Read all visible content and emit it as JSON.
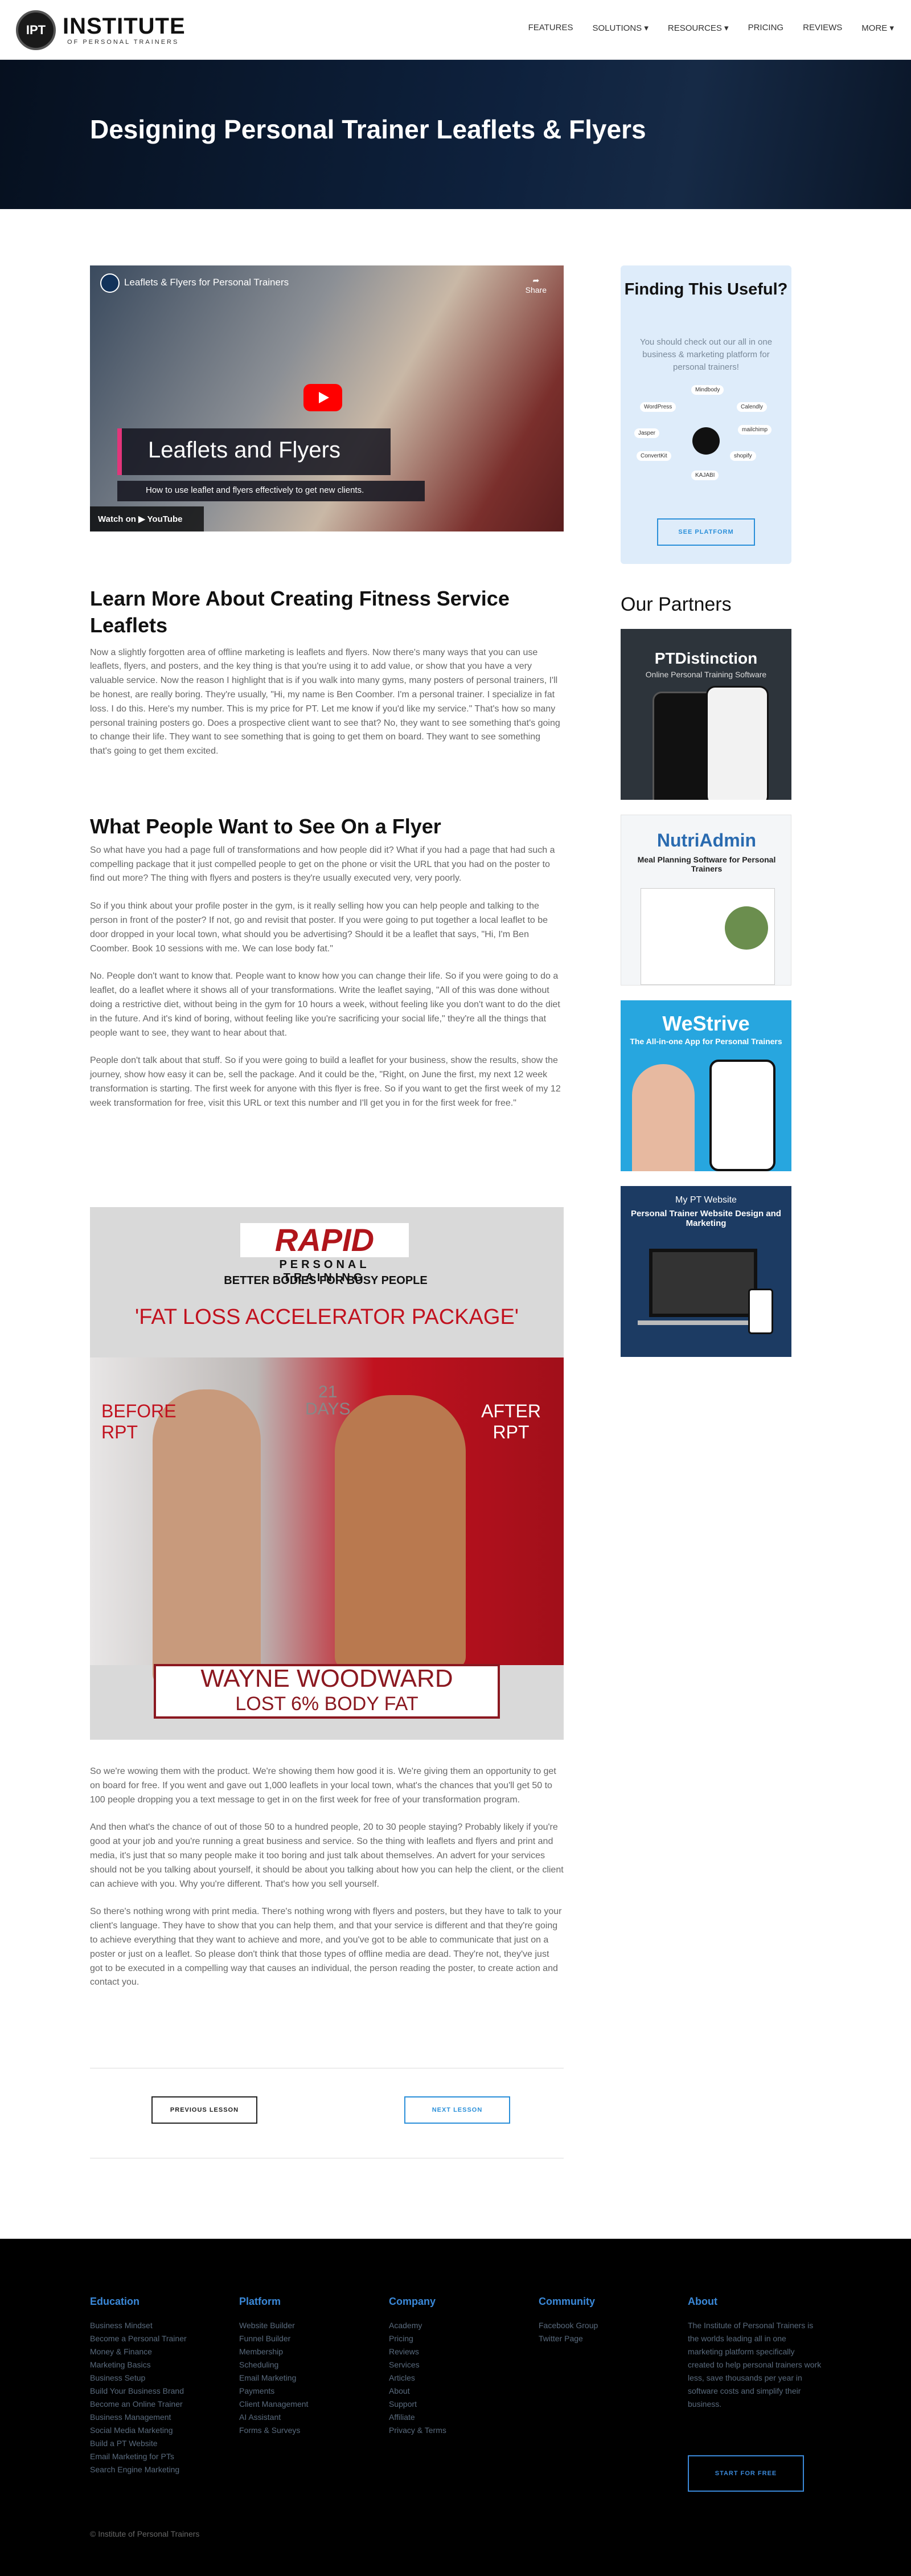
{
  "nav": {
    "logo_mark": "IPT",
    "logo_title": "INSTITUTE",
    "logo_sub": "OF PERSONAL TRAINERS",
    "items": [
      "FEATURES",
      "SOLUTIONS ▾",
      "RESOURCES ▾",
      "PRICING",
      "REVIEWS",
      "MORE ▾"
    ]
  },
  "hero": {
    "title": "Designing Personal Trainer Leaflets & Flyers"
  },
  "video": {
    "title": "Leaflets & Flyers for Personal Trainers",
    "share": "Share",
    "band": "Leaflets and Flyers",
    "subtitle": "How to use leaflet and flyers effectively to get new clients.",
    "watch": "Watch on ▶ YouTube"
  },
  "article": {
    "h1": "Learn More About Creating Fitness Service Leaflets",
    "p1": "Now a slightly forgotten area of offline marketing is leaflets and flyers. Now there's many ways that you can use leaflets, flyers, and posters, and the key thing is that you're using it to add value, or show that you have a very valuable service. Now the reason I highlight that is if you walk into many gyms, many posters of personal trainers, I'll be honest, are really boring. They're usually, \"Hi, my name is Ben Coomber. I'm a personal trainer. I specialize in fat loss. I do this. Here's my number. This is my price for PT. Let me know if you'd like my service.\" That's how so many personal training posters go. Does a prospective client want to see that? No, they want to see something that's going to change their life. They want to see something that is going to get them on board. They want to see something that's going to get them excited.",
    "h2": "What People Want to See On a Flyer",
    "p2": "So what have you had a page full of transformations and how people did it? What if you had a page that had such a compelling package that it just compelled people to get on the phone or visit the URL that you had on the poster to find out more? The thing with flyers and posters is they're usually executed very, very poorly.",
    "p3": "So if you think about your profile poster in the gym, is it really selling how you can help people and talking to the person in front of the poster? If not, go and revisit that poster. If you were going to put together a local leaflet to be door dropped in your local town, what should you be advertising? Should it be a leaflet that says, \"Hi, I'm Ben Coomber. Book 10 sessions with me. We can lose body fat.\"",
    "p4": "No. People don't want to know that. People want to know how you can change their life. So if you were going to do a leaflet, do a leaflet where it shows all of your transformations. Write the leaflet saying, \"All of this was done without doing a restrictive diet, without being in the gym for 10 hours a week, without feeling like you don't want to do the diet in the future. And it's kind of boring, without feeling like you're sacrificing your social life,\" they're all the things that people want to see, they want to hear about that.",
    "p5": "People don't talk about that stuff. So if you were going to build a leaflet for your business, show the results, show the journey, show how easy it can be, sell the package. And it could be the, \"Right, on June the first, my next 12 week transformation is starting. The first week for anyone with this flyer is free. So if you want to get the first week of my 12 week transformation for free, visit this URL or text this number and I'll get you in for the first week for free.\"",
    "p6": "So we're wowing them with the product. We're showing them how good it is. We're giving them an opportunity to get on board for free. If you went and gave out 1,000 leaflets in your local town, what's the chances that you'll get 50 to 100 people dropping you a text message to get in on the first week for free of your transformation program.",
    "p7": "And then what's the chance of out of those 50 to a hundred people, 20 to 30 people staying? Probably likely if you're good at your job and you're running a great business and service. So the thing with leaflets and flyers and print and media, it's just that so many people make it too boring and just talk about themselves. An advert for your services should not be you talking about yourself, it should be about you talking about how you can help the client, or the client can achieve with you. Why you're different. That's how you sell yourself.",
    "p8": "So there's nothing wrong with print media. There's nothing wrong with flyers and posters, but they have to talk to your client's language. They have to show that you can help them, and that your service is different and that they're going to achieve everything that they want to achieve and more, and you've got to be able to communicate that just on a poster or just on a leaflet. So please don't think that those types of offline media are dead. They're not, they've just got to be executed in a compelling way that causes an individual, the person reading the poster, to create action and contact you.",
    "prev": "PREVIOUS LESSON",
    "next": "NEXT LESSON"
  },
  "poster": {
    "brand": "RAPID",
    "brand_sub": "PERSONAL TRAINING",
    "tagline": "BETTER BODIES FOR BUSY PEOPLE",
    "package": "'FAT LOSS ACCELERATOR PACKAGE'",
    "before": "BEFORE\nRPT",
    "after": "AFTER\nRPT",
    "days": "21\nDAYS",
    "name": "WAYNE WOODWARD",
    "result": "LOST 6% BODY FAT"
  },
  "sidebar": {
    "title": "Finding This Useful?",
    "text": "You should check out our all in one business & marketing platform for personal trainers!",
    "hub_labels": [
      "Mindbody",
      "Calendly",
      "mailchimp",
      "shopify",
      "KAJABI",
      "ConvertKit",
      "Jasper",
      "WordPress"
    ],
    "button": "SEE PLATFORM",
    "partners_heading": "Our Partners",
    "partners": [
      {
        "title": "PTDistinction",
        "sub": "Online Personal Training Software"
      },
      {
        "title": "NutriAdmin",
        "sub": "Meal Planning Software for Personal Trainers"
      },
      {
        "title": "WeStrive",
        "sub": "The All-in-one App for Personal Trainers"
      },
      {
        "title": "My PT Website",
        "sub": "Personal Trainer Website Design and Marketing"
      }
    ]
  },
  "footer": {
    "columns": [
      {
        "title": "Education",
        "links": [
          "Business Mindset",
          "Become a Personal Trainer",
          "Money & Finance",
          "Marketing Basics",
          "Business Setup",
          "Build Your Business Brand",
          "Become an Online Trainer",
          "Business Management",
          "Social Media Marketing",
          "Build a PT Website",
          "Email Marketing for PTs",
          "Search Engine Marketing"
        ]
      },
      {
        "title": "Platform",
        "links": [
          "Website Builder",
          "Funnel Builder",
          "Membership",
          "Scheduling",
          "Email Marketing",
          "Payments",
          "Client Management",
          "AI Assistant",
          "Forms & Surveys"
        ]
      },
      {
        "title": "Company",
        "links": [
          "Academy",
          "Pricing",
          "Reviews",
          "Services",
          "Articles",
          "About",
          "Support",
          "Affiliate",
          "Privacy & Terms"
        ]
      },
      {
        "title": "Community",
        "links": [
          "Facebook Group",
          "Twitter Page"
        ]
      },
      {
        "title": "About",
        "links": [
          "The Institute of Personal Trainers is the worlds leading all in one marketing platform specifically created to help personal trainers work less, save thousands per year in software costs and simplify their business."
        ]
      }
    ],
    "cta": "START FOR FREE",
    "copyright": "© Institute of Personal Trainers"
  }
}
